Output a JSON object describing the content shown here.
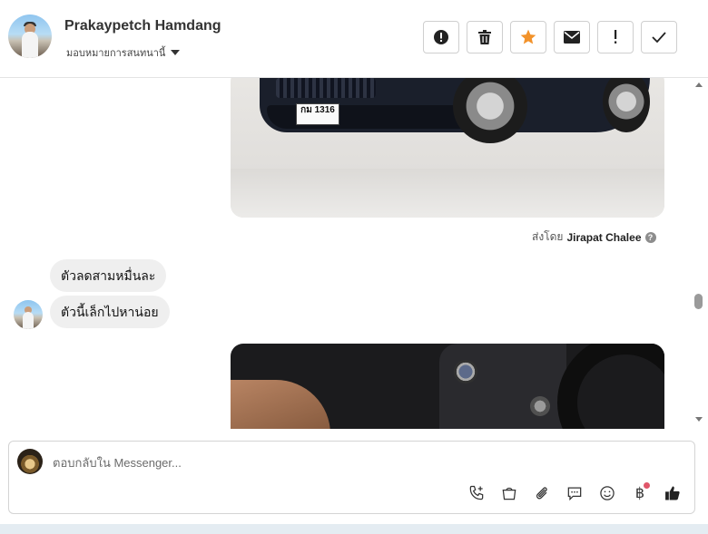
{
  "header": {
    "contact_name": "Prakaypetch Hamdang",
    "assign_label": "มอบหมายการสนทนานี้",
    "actions": [
      {
        "name": "report-button",
        "icon": "alert-circle-icon",
        "glyph": "!"
      },
      {
        "name": "delete-button",
        "icon": "trash-icon",
        "glyph": ""
      },
      {
        "name": "star-button",
        "icon": "star-icon",
        "glyph": "★"
      },
      {
        "name": "mark-unread-button",
        "icon": "envelope-icon",
        "glyph": "✉"
      },
      {
        "name": "mark-important-button",
        "icon": "exclamation-icon",
        "glyph": "!"
      },
      {
        "name": "mark-done-button",
        "icon": "check-icon",
        "glyph": "✓"
      }
    ],
    "accent_star": "#f2922a"
  },
  "conversation": {
    "car_image": {
      "plate_text": "กม 1316"
    },
    "sender_prefix": "ส่งโดย",
    "sender_name": "Jirapat Chalee",
    "messages": [
      {
        "text": "ตัวลดสามหมื่นละ"
      },
      {
        "text": "ตัวนี้เล็กไปหาน่อย"
      }
    ]
  },
  "reply": {
    "placeholder": "ตอบกลับใน Messenger...",
    "tools": [
      "call-add-icon",
      "shopping-bag-icon",
      "paperclip-icon",
      "chat-bubble-icon",
      "emoji-icon",
      "baht-icon",
      "thumbs-up-icon"
    ],
    "baht_glyph": "฿",
    "notification_color": "#e0566a"
  }
}
